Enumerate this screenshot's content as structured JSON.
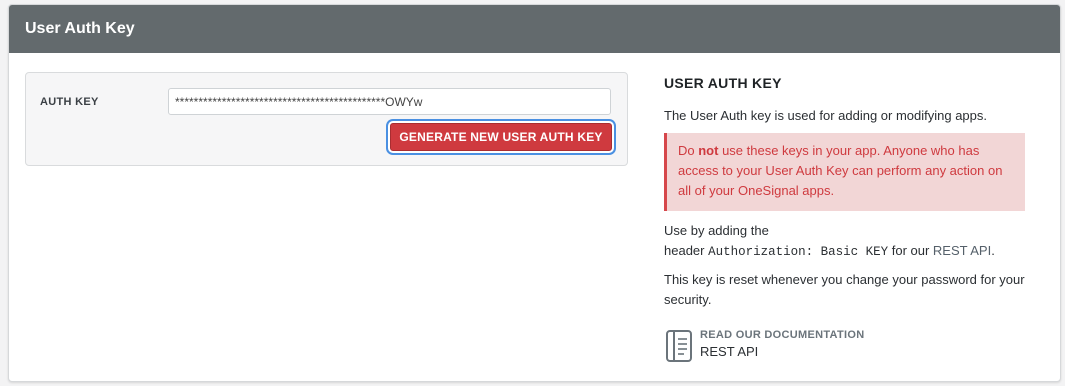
{
  "panel": {
    "title": "User Auth Key"
  },
  "auth_key": {
    "label": "AUTH KEY",
    "value": "*********************************************OWYw",
    "generate_button_label": "GENERATE NEW USER AUTH KEY"
  },
  "info": {
    "heading": "USER AUTH KEY",
    "description": "The User Auth key is used for adding or modifying apps.",
    "warning": {
      "prefix": "Do ",
      "emphasis": "not",
      "suffix": " use these keys in your app. Anyone who has access to your User Auth Key can perform any action on all of your OneSignal apps."
    },
    "usage": {
      "line1": "Use by adding the",
      "header_prefix": "header ",
      "code": "Authorization: Basic KEY",
      "middle": " for our ",
      "link": "REST API",
      "end": "."
    },
    "reset_note": "This key is reset whenever you change your password for your security.",
    "documentation": {
      "label": "READ OUR DOCUMENTATION",
      "link": "REST API",
      "icon": "book-icon"
    }
  },
  "colors": {
    "header_bg": "#636a6d",
    "button_red": "#cf3a3f",
    "warning_bg": "#f2d6d6",
    "warning_text": "#cf3a3f",
    "focus_ring": "#4a90e2"
  }
}
